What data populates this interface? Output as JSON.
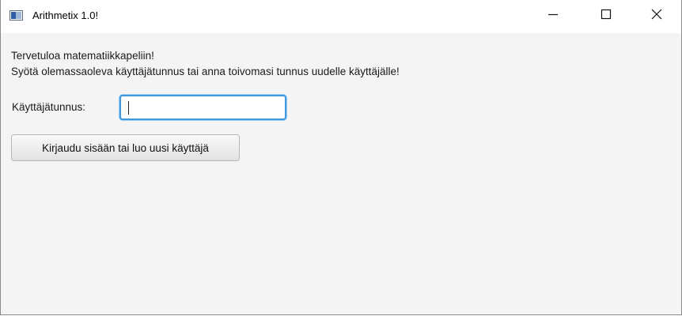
{
  "window": {
    "title": "Arithmetix 1.0!",
    "icon": "app-window-icon",
    "controls": {
      "minimize_icon": "minimize-icon",
      "maximize_icon": "maximize-icon",
      "close_icon": "close-icon"
    }
  },
  "content": {
    "welcome_line1": "Tervetuloa matematiikkapeliin!",
    "welcome_line2": "Syötä olemassaoleva käyttäjätunnus tai anna toivomasi tunnus uudelle käyttäjälle!",
    "username_label": "Käyttäjätunnus:",
    "username_value": "",
    "login_button_label": "Kirjaudu sisään tai luo uusi käyttäjä"
  },
  "colors": {
    "focus_border": "#3d9ae0",
    "window_background": "#f4f4f4",
    "titlebar_background": "#ffffff"
  }
}
